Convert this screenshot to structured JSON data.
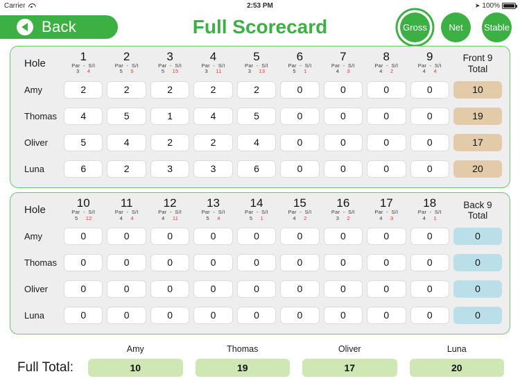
{
  "status_bar": {
    "carrier": "Carrier",
    "wifi_icon": "wifi-icon",
    "time": "2:53 PM",
    "location_icon": "location-arrow-icon",
    "battery_percent": "100%",
    "battery_icon": "battery-full-icon"
  },
  "nav": {
    "back_label": "Back",
    "back_icon": "chevron-left-circle-icon",
    "title": "Full Scorecard",
    "modes": [
      {
        "label": "Gross",
        "active": true
      },
      {
        "label": "Net",
        "active": false
      },
      {
        "label": "Stable",
        "active": false
      }
    ]
  },
  "theme": {
    "green": "#3cb043",
    "card_border": "#68c96f",
    "card_bg": "#eeeeee",
    "front_total_bg": "#e3caa8",
    "back_total_bg": "#bbdfe8",
    "full_total_bg": "#cfe6b5",
    "si_red": "#e03b2f"
  },
  "labels": {
    "hole": "Hole",
    "par_si": "Par  -  S/I",
    "par_text": "Par",
    "dash": "-",
    "si_text": "S/I",
    "full_total": "Full Total:"
  },
  "front_nine": {
    "total_header_line1": "Front 9",
    "total_header_line2": "Total",
    "holes": [
      {
        "number": "1",
        "par": "3",
        "si": "4"
      },
      {
        "number": "2",
        "par": "5",
        "si": "5"
      },
      {
        "number": "3",
        "par": "5",
        "si": "15"
      },
      {
        "number": "4",
        "par": "3",
        "si": "11"
      },
      {
        "number": "5",
        "par": "3",
        "si": "13"
      },
      {
        "number": "6",
        "par": "5",
        "si": "1"
      },
      {
        "number": "7",
        "par": "4",
        "si": "3"
      },
      {
        "number": "8",
        "par": "4",
        "si": "2"
      },
      {
        "number": "9",
        "par": "4",
        "si": "4"
      }
    ],
    "rows": [
      {
        "player": "Amy",
        "scores": [
          "2",
          "2",
          "2",
          "2",
          "2",
          "0",
          "0",
          "0",
          "0"
        ],
        "total": "10"
      },
      {
        "player": "Thomas",
        "scores": [
          "4",
          "5",
          "1",
          "4",
          "5",
          "0",
          "0",
          "0",
          "0"
        ],
        "total": "19"
      },
      {
        "player": "Oliver",
        "scores": [
          "5",
          "4",
          "2",
          "2",
          "4",
          "0",
          "0",
          "0",
          "0"
        ],
        "total": "17"
      },
      {
        "player": "Luna",
        "scores": [
          "6",
          "2",
          "3",
          "3",
          "6",
          "0",
          "0",
          "0",
          "0"
        ],
        "total": "20"
      }
    ]
  },
  "back_nine": {
    "total_header_line1": "Back 9",
    "total_header_line2": "Total",
    "holes": [
      {
        "number": "10",
        "par": "5",
        "si": "12"
      },
      {
        "number": "11",
        "par": "4",
        "si": "4"
      },
      {
        "number": "12",
        "par": "4",
        "si": "11"
      },
      {
        "number": "13",
        "par": "5",
        "si": "4"
      },
      {
        "number": "14",
        "par": "5",
        "si": "1"
      },
      {
        "number": "15",
        "par": "4",
        "si": "2"
      },
      {
        "number": "16",
        "par": "3",
        "si": "2"
      },
      {
        "number": "17",
        "par": "4",
        "si": "3"
      },
      {
        "number": "18",
        "par": "4",
        "si": "1"
      }
    ],
    "rows": [
      {
        "player": "Amy",
        "scores": [
          "0",
          "0",
          "0",
          "0",
          "0",
          "0",
          "0",
          "0",
          "0"
        ],
        "total": "0"
      },
      {
        "player": "Thomas",
        "scores": [
          "0",
          "0",
          "0",
          "0",
          "0",
          "0",
          "0",
          "0",
          "0"
        ],
        "total": "0"
      },
      {
        "player": "Oliver",
        "scores": [
          "0",
          "0",
          "0",
          "0",
          "0",
          "0",
          "0",
          "0",
          "0"
        ],
        "total": "0"
      },
      {
        "player": "Luna",
        "scores": [
          "0",
          "0",
          "0",
          "0",
          "0",
          "0",
          "0",
          "0",
          "0"
        ],
        "total": "0"
      }
    ]
  },
  "footer": {
    "label": "Full Total:",
    "totals": [
      {
        "player": "Amy",
        "value": "10"
      },
      {
        "player": "Thomas",
        "value": "19"
      },
      {
        "player": "Oliver",
        "value": "17"
      },
      {
        "player": "Luna",
        "value": "20"
      }
    ]
  }
}
